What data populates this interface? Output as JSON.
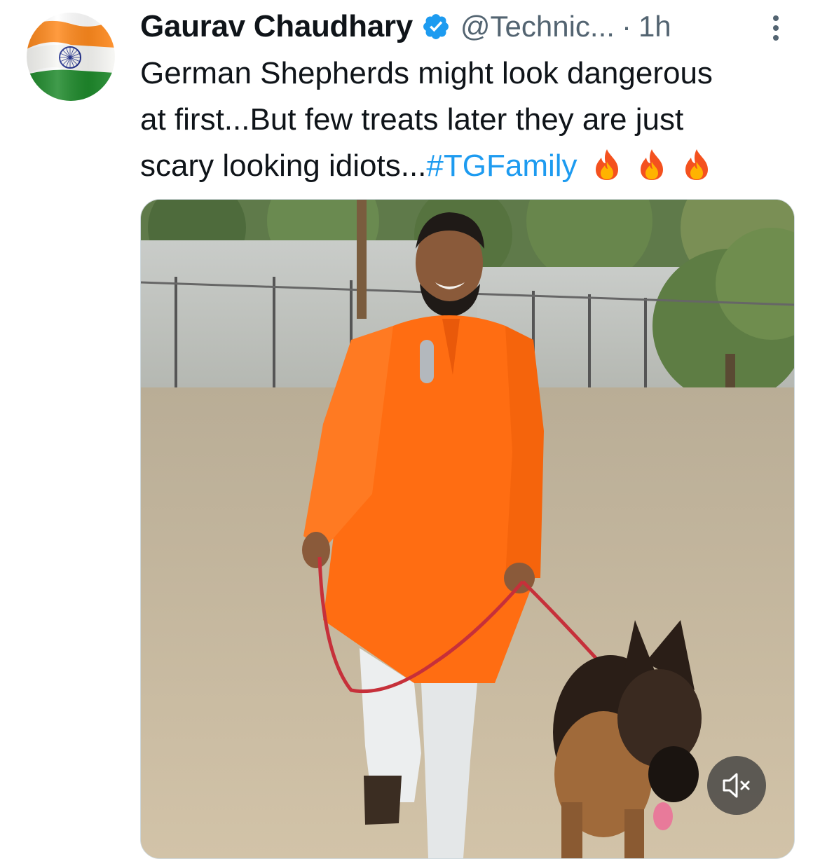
{
  "tweet": {
    "author": {
      "display_name": "Gaurav Chaudhary",
      "handle": "@Technic...",
      "verified_icon": "verified-badge-icon",
      "avatar_icon": "india-flag-icon"
    },
    "separator": "·",
    "time": "1h",
    "text": {
      "line1": "German Shepherds might look dangerous",
      "line2": "at first...But few treats later they are just",
      "line3_prefix": "scary looking idiots...",
      "hashtag": "#TGFamily",
      "emoji_icons": [
        "fire-icon",
        "fire-icon",
        "fire-icon"
      ]
    },
    "media": {
      "type": "video",
      "mute_icon": "volume-muted-icon"
    }
  },
  "colors": {
    "text": "#0f1419",
    "secondary": "#536471",
    "accent": "#1d9bf0",
    "flag_saffron": "#ff8a1e",
    "flag_green": "#1f8a2c",
    "chakra": "#1b2a8a",
    "kurta": "#ff6d12"
  }
}
